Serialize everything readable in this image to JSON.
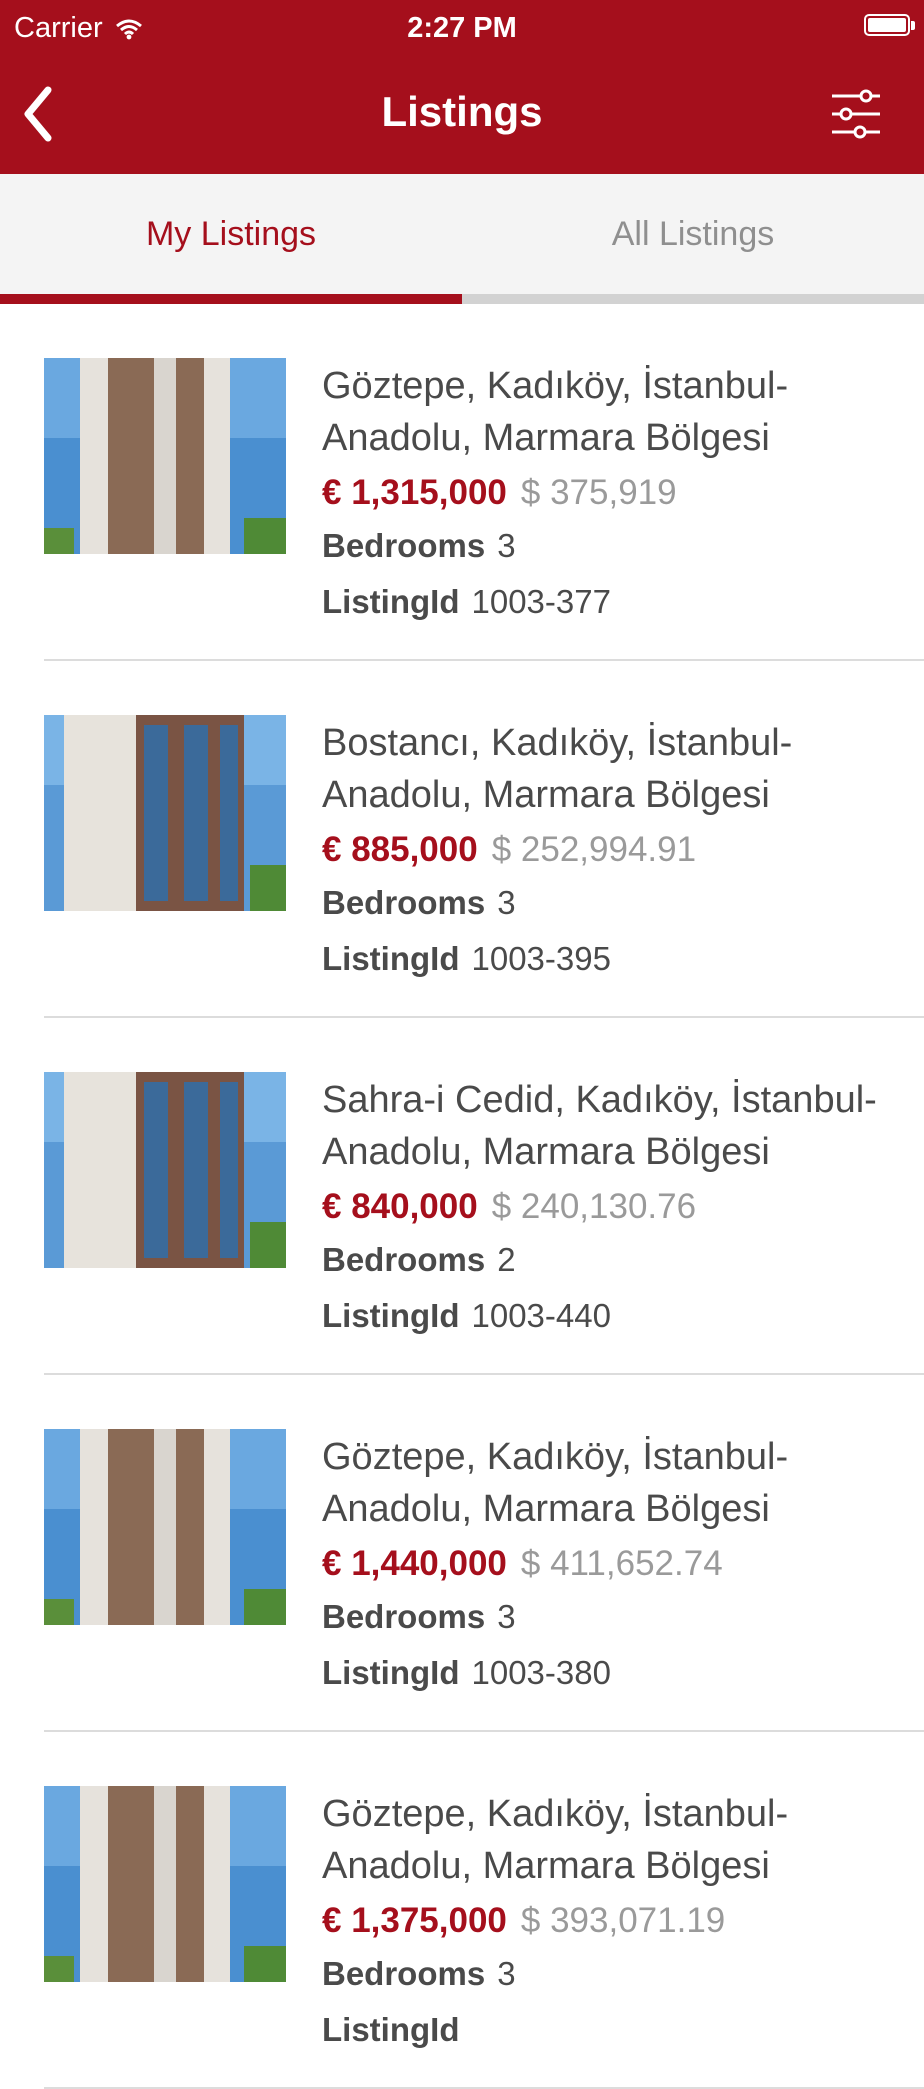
{
  "status": {
    "carrier": "Carrier",
    "time": "2:27 PM"
  },
  "header": {
    "title": "Listings"
  },
  "tabs": [
    {
      "label": "My Listings"
    },
    {
      "label": "All Listings"
    }
  ],
  "listings": [
    {
      "location": "Göztepe, Kadıköy, İstanbul-Anadolu, Marmara Bölgesi",
      "price_eur": "€ 1,315,000",
      "price_usd": "$ 375,919",
      "bedrooms_label": "Bedrooms",
      "bedrooms": "3",
      "id_label": "ListingId",
      "id": "1003-377"
    },
    {
      "location": "Bostancı, Kadıköy, İstanbul-Anadolu, Marmara Bölgesi",
      "price_eur": "€ 885,000",
      "price_usd": "$ 252,994.91",
      "bedrooms_label": "Bedrooms",
      "bedrooms": "3",
      "id_label": "ListingId",
      "id": "1003-395"
    },
    {
      "location": "Sahra-i Cedid, Kadıköy, İstanbul-Anadolu, Marmara Bölgesi",
      "price_eur": "€ 840,000",
      "price_usd": "$ 240,130.76",
      "bedrooms_label": "Bedrooms",
      "bedrooms": "2",
      "id_label": "ListingId",
      "id": "1003-440"
    },
    {
      "location": "Göztepe, Kadıköy, İstanbul-Anadolu, Marmara Bölgesi",
      "price_eur": "€ 1,440,000",
      "price_usd": "$ 411,652.74",
      "bedrooms_label": "Bedrooms",
      "bedrooms": "3",
      "id_label": "ListingId",
      "id": "1003-380"
    },
    {
      "location": "Göztepe, Kadıköy, İstanbul-Anadolu, Marmara Bölgesi",
      "price_eur": "€ 1,375,000",
      "price_usd": "$ 393,071.19",
      "bedrooms_label": "Bedrooms",
      "bedrooms": "3",
      "id_label": "ListingId",
      "id": ""
    }
  ],
  "colors": {
    "brand": "#a50f1c",
    "muted": "#9a9a9a",
    "text": "#4a4a4a"
  },
  "icons": {
    "back": "chevron-left-icon",
    "filter": "sliders-icon",
    "wifi": "wifi-icon",
    "battery": "battery-icon"
  }
}
